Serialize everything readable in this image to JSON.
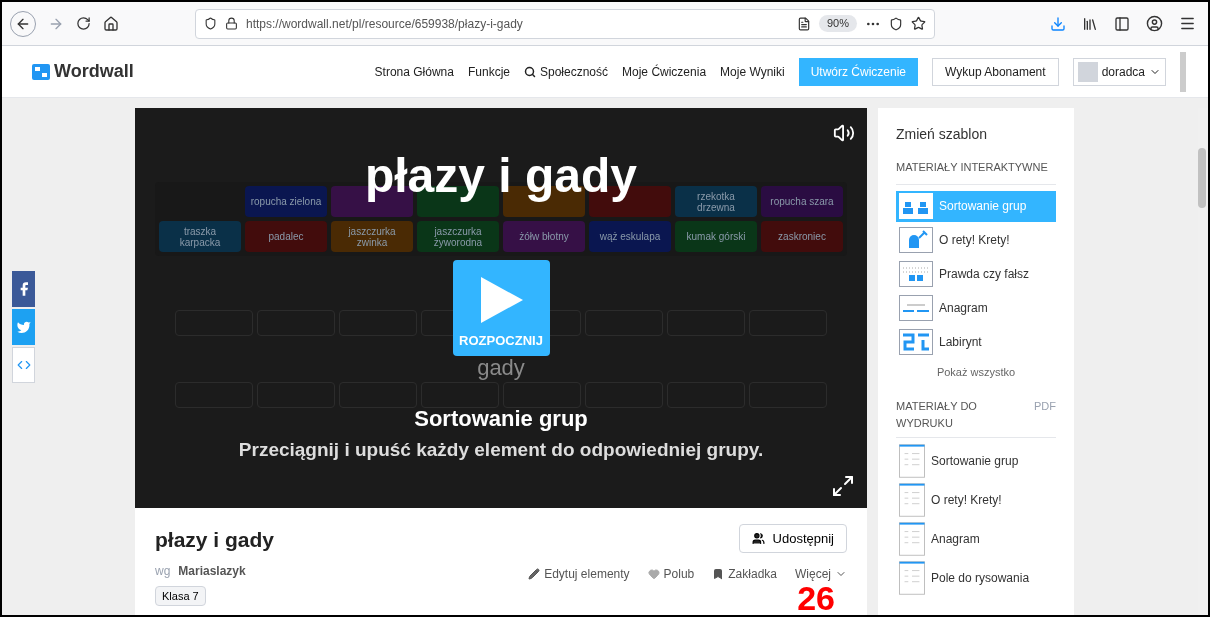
{
  "browser": {
    "url": "https://wordwall.net/pl/resource/659938/płazy-i-gady",
    "zoom": "90%"
  },
  "header": {
    "logo": "Wordwall",
    "nav": [
      {
        "label": "Strona Główna",
        "kind": "link"
      },
      {
        "label": "Funkcje",
        "kind": "link"
      },
      {
        "label": "Społeczność",
        "kind": "search"
      },
      {
        "label": "Moje Ćwiczenia",
        "kind": "link"
      },
      {
        "label": "Moje Wyniki",
        "kind": "link"
      }
    ],
    "create_button": "Utwórz Ćwiczenie",
    "subscribe_button": "Wykup Abonament",
    "user": "doradca"
  },
  "social": [
    {
      "kind": "facebook"
    },
    {
      "kind": "twitter"
    },
    {
      "kind": "embed"
    }
  ],
  "game": {
    "title": "płazy i gady",
    "tiles_row_1": [
      {
        "text": "ropucha zielona",
        "color": "#0a1650"
      },
      {
        "color": "#361046"
      },
      {
        "color": "#0a3618"
      },
      {
        "color": "#4a2a04"
      },
      {
        "color": "#420c0c"
      },
      {
        "text": "rzekotka drzewna",
        "color": "#0a3048"
      },
      {
        "text": "ropucha szara",
        "color": "#2a0c42"
      }
    ],
    "tiles_row_2": [
      {
        "text": "traszka karpacka",
        "color": "#0a3048"
      },
      {
        "text": "padalec",
        "color": "#420c0c"
      },
      {
        "text": "jaszczurka zwinka",
        "color": "#4a2a04"
      },
      {
        "text": "jaszczurka żyworodna",
        "color": "#0a3618"
      },
      {
        "text": "żółw błotny",
        "color": "#361046"
      },
      {
        "text": "wąż eskulapa",
        "color": "#0a1650"
      },
      {
        "text": "kumak górski",
        "color": "#0a3618"
      },
      {
        "text": "zaskroniec",
        "color": "#420c0c"
      }
    ],
    "group_label": "gady",
    "start_button": "ROZPOCZNIJ",
    "template": "Sortowanie grup",
    "instruction": "Przeciągnij i upuść każdy element do odpowiedniej grupy."
  },
  "info": {
    "title": "płazy i gady",
    "by": "wg",
    "author": "Mariaslazyk",
    "tags": [
      "Klasa 7"
    ],
    "share_button": "Udostępnij",
    "actions": [
      {
        "label": "Edytuj elementy",
        "kind": "edit"
      },
      {
        "label": "Polub",
        "kind": "like"
      },
      {
        "label": "Zakładka",
        "kind": "bookmark"
      },
      {
        "label": "Więcej",
        "kind": "more"
      }
    ]
  },
  "page_number": "26",
  "sidebar": {
    "title": "Zmień szablon",
    "interactive_heading": "MATERIAŁY INTERAKTYWNE",
    "interactive": [
      {
        "label": "Sortowanie grup",
        "selected": true,
        "kind": "sort"
      },
      {
        "label": "O rety! Krety!",
        "selected": false,
        "kind": "mole"
      },
      {
        "label": "Prawda czy fałsz",
        "selected": false,
        "kind": "truefalse"
      },
      {
        "label": "Anagram",
        "selected": false,
        "kind": "anagram"
      },
      {
        "label": "Labirynt",
        "selected": false,
        "kind": "maze"
      }
    ],
    "show_all": "Pokaż wszystko",
    "printables_heading": "MATERIAŁY DO WYDRUKU",
    "pdf": "PDF",
    "printables": [
      "Sortowanie grup",
      "O rety! Krety!",
      "Anagram",
      "Pole do rysowania"
    ]
  }
}
